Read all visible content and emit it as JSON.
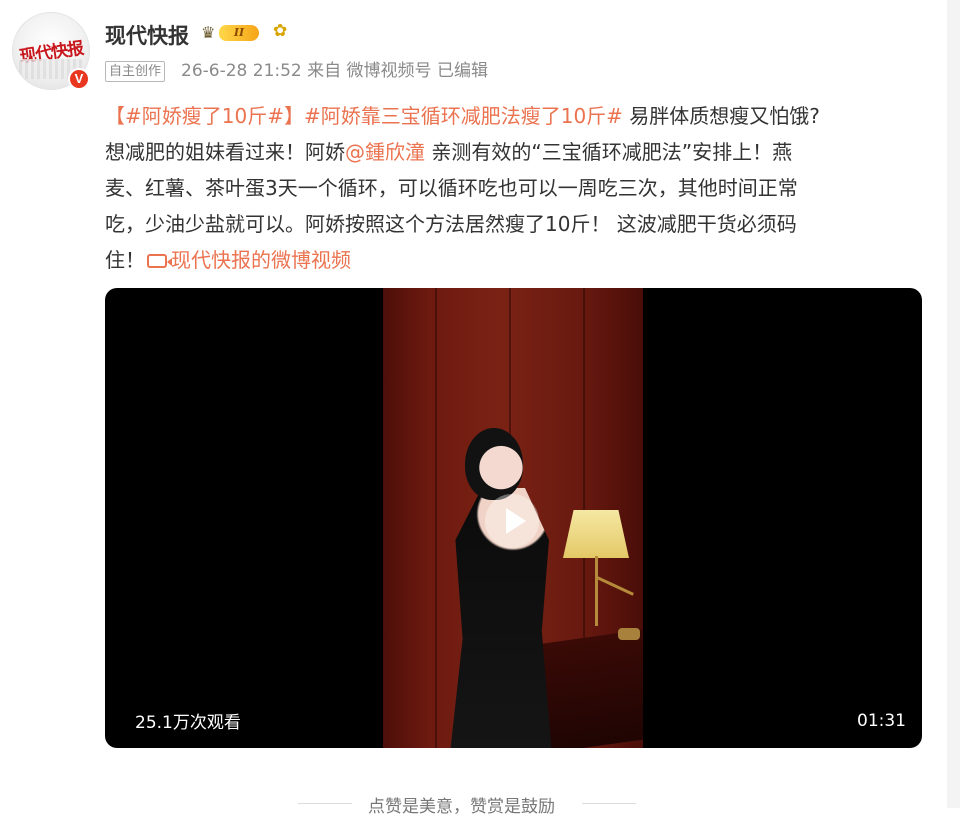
{
  "author": {
    "name": "现代快报",
    "avatar_text": "现代快报",
    "verified_icon": "v-verified-icon",
    "level_badge": "II",
    "level_icon": "crown-icon",
    "sun_icon": "sunflower-icon"
  },
  "meta": {
    "tag": "自主创作",
    "text": "26-6-28 21:52 来自 微博视频号 已编辑"
  },
  "post": {
    "line1": {
      "topic1": "【#阿娇瘦了10斤#】",
      "topic2": "#阿娇靠三宝循环减肥法瘦了10斤#",
      "rest": " 易胖体质想瘦又怕饿?"
    },
    "line2": {
      "before": "想减肥的姐妹看过来！阿娇",
      "mention": "@鍾欣潼",
      "after": " 亲测有效的“三宝循环减肥法”安排上！燕"
    },
    "line3": "麦、红薯、茶叶蛋3天一个循环，可以循环吃也可以一周吃三次，其他时间正常",
    "line4": "吃，少油少盐就可以。阿娇按照这个方法居然瘦了10斤！  这波减肥干货必须码",
    "line5": {
      "before": "住！",
      "video_link": "现代快报的微博视频"
    }
  },
  "video": {
    "views": "25.1万次观看",
    "duration": "01:31",
    "play_icon": "play-icon"
  },
  "footer": {
    "text": "点赞是美意，赞赏是鼓励"
  },
  "colors": {
    "accent": "#eb7350",
    "text": "#333333",
    "meta": "#8a8a8a",
    "verified": "#e8361f"
  }
}
